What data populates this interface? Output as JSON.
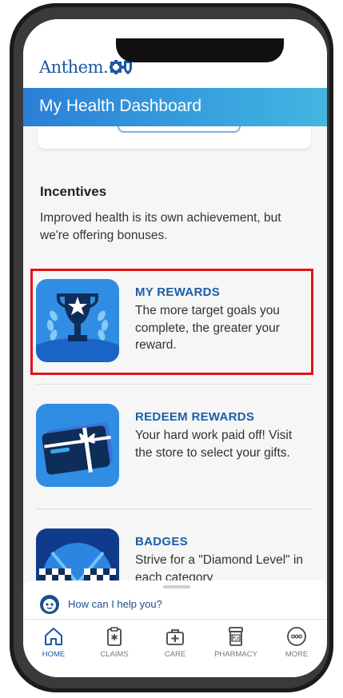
{
  "brand": {
    "name": "Anthem."
  },
  "header": {
    "title": "My Health Dashboard"
  },
  "incentives": {
    "title": "Incentives",
    "description": "Improved health is its own achievement, but we're offering bonuses."
  },
  "items": [
    {
      "title": "MY REWARDS",
      "description": "The more target goals you complete, the greater your reward.",
      "icon": "trophy-icon",
      "highlighted": true
    },
    {
      "title": "REDEEM REWARDS",
      "description": "Your hard work paid off! Visit the store to select your gifts.",
      "icon": "gift-card-icon"
    },
    {
      "title": "BADGES",
      "description": "Strive for a \"Diamond Level\" in each category",
      "icon": "checkered-flags-icon"
    }
  ],
  "assistant": {
    "prompt": "How can I help you?",
    "icon": "chat-assistant-icon"
  },
  "tabs": [
    {
      "label": "HOME",
      "icon": "home-icon",
      "active": true
    },
    {
      "label": "CLAIMS",
      "icon": "clipboard-icon"
    },
    {
      "label": "CARE",
      "icon": "medical-bag-icon"
    },
    {
      "label": "PHARMACY",
      "icon": "prescription-bottle-icon"
    },
    {
      "label": "MORE",
      "icon": "more-icon"
    }
  ],
  "colors": {
    "accent": "#1d57a3",
    "header_gradient_start": "#2a7fd6",
    "highlight": "#e3121b"
  }
}
